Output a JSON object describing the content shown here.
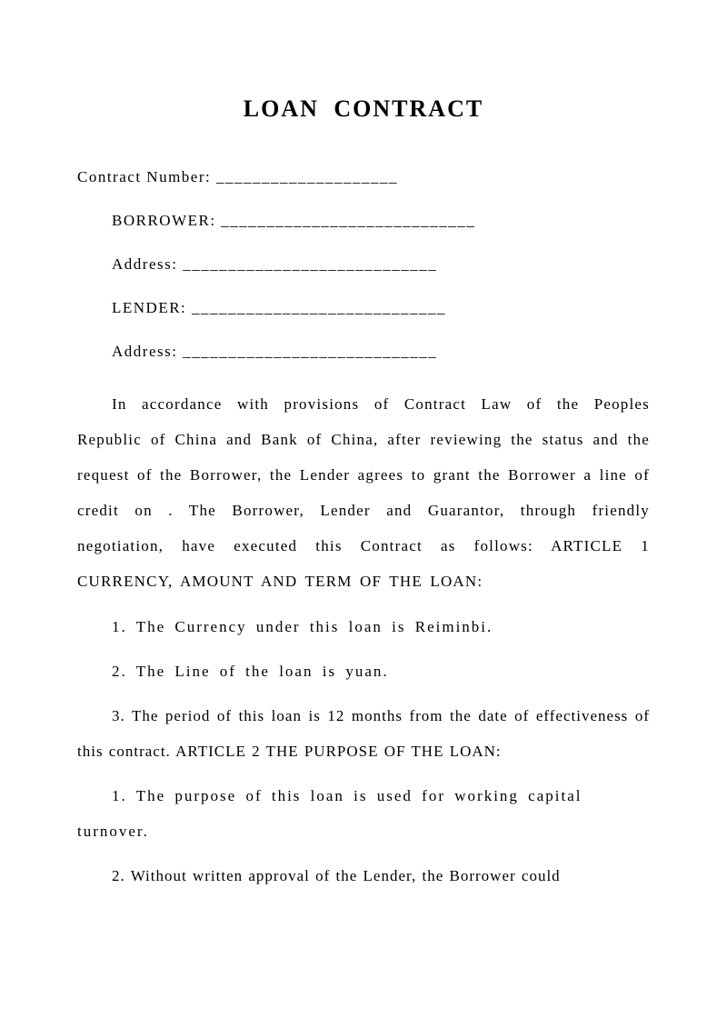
{
  "title": "LOAN CONTRACT",
  "fields": {
    "contract_number_label": "Contract Number: ____________________",
    "borrower_label": "BORROWER: ____________________________",
    "borrower_address_label": "Address: ____________________________",
    "lender_label": "LENDER:  ____________________________",
    "lender_address_label": "Address: ____________________________"
  },
  "intro": "In accordance with provisions of Contract Law of the Peoples Republic of China and Bank of China,  after reviewing the status and the request of the Borrower,  the Lender agrees to grant the Borrower a line of credit on . The Borrower,  Lender and Guarantor,  through friendly negotiation,  have executed this Contract as follows:  ARTICLE 1 CURRENCY,  AMOUNT AND TERM OF THE LOAN:",
  "items": {
    "a1_1": "1. The Currency under this loan is Reiminbi.",
    "a1_2": "2. The Line of the loan is yuan.",
    "a1_3": "3. The period of this loan is 12 months from the date of effectiveness of this contract. ARTICLE 2 THE PURPOSE OF THE LOAN:",
    "a2_1": "1. The purpose of this loan is used for working capital turnover.",
    "a2_2": "2. Without written approval of the Lender,  the Borrower could"
  }
}
